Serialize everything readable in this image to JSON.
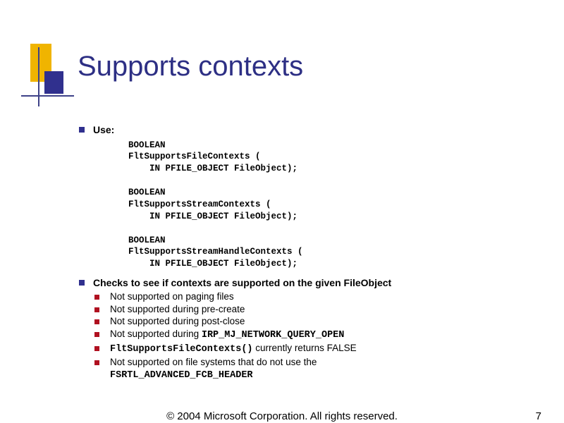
{
  "title": "Supports contexts",
  "bullets": {
    "use_label": "Use:",
    "checks_label": "Checks to see if contexts are supported on the given FileObject",
    "sub": {
      "s1": "Not supported on paging files",
      "s2": "Not supported during pre-create",
      "s3": "Not supported during post-close",
      "s4_a": "Not supported during ",
      "s4_b": "IRP_MJ_NETWORK_QUERY_OPEN",
      "s5_a": "FltSupportsFileContexts()",
      "s5_b": " currently returns FALSE",
      "s6_a": "Not supported on file systems that do not use the ",
      "s6_b": "FSRTL_ADVANCED_FCB_HEADER"
    }
  },
  "code": {
    "l1": "BOOLEAN",
    "l2": "FltSupportsFileContexts (",
    "l3": "    IN PFILE_OBJECT FileObject);",
    "l4": "",
    "l5": "BOOLEAN",
    "l6": "FltSupportsStreamContexts (",
    "l7": "    IN PFILE_OBJECT FileObject);",
    "l8": "",
    "l9": "BOOLEAN",
    "l10": "FltSupportsStreamHandleContexts (",
    "l11": "    IN PFILE_OBJECT FileObject);"
  },
  "footer": {
    "copy": "© 2004 Microsoft Corporation. All rights reserved.",
    "page": "7"
  }
}
